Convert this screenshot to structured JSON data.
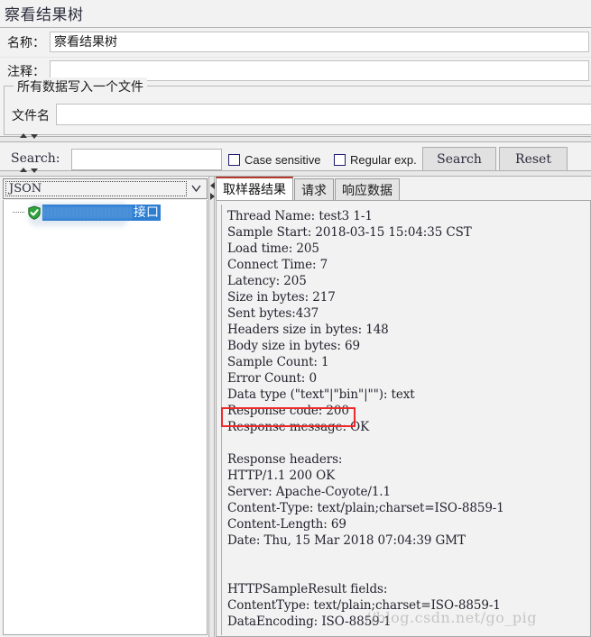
{
  "window": {
    "title": "察看结果树"
  },
  "form": {
    "name_label": "名称：",
    "name_value": "察看结果树",
    "comment_label": "注释：",
    "comment_value": "",
    "file_group_legend": "所有数据写入一个文件",
    "filename_label": "文件名",
    "filename_value": ""
  },
  "search": {
    "label": "Search:",
    "value": "",
    "case_sensitive_label": "Case sensitive",
    "case_sensitive_checked": false,
    "regular_exp_label": "Regular exp.",
    "regular_exp_checked": false,
    "search_button": "Search",
    "reset_button": "Reset"
  },
  "left_panel": {
    "renderer_selected": "JSON",
    "tree": {
      "node_label_visible": "接口",
      "node_status": "success"
    }
  },
  "right_panel": {
    "tabs": [
      {
        "label": "取样器结果",
        "active": true
      },
      {
        "label": "请求",
        "active": false
      },
      {
        "label": "响应数据",
        "active": false
      }
    ],
    "result_text": "Thread Name: test3 1-1\nSample Start: 2018-03-15 15:04:35 CST\nLoad time: 205\nConnect Time: 7\nLatency: 205\nSize in bytes: 217\nSent bytes:437\nHeaders size in bytes: 148\nBody size in bytes: 69\nSample Count: 1\nError Count: 0\nData type (\"text\"|\"bin\"|\"\"): text\nResponse code: 200\nResponse message: OK\n\nResponse headers:\nHTTP/1.1 200 OK\nServer: Apache-Coyote/1.1\nContent-Type: text/plain;charset=ISO-8859-1\nContent-Length: 69\nDate: Thu, 15 Mar 2018 07:04:39 GMT\n\n\nHTTPSampleResult fields:\nContentType: text/plain;charset=ISO-8859-1\nDataEncoding: ISO-8859-1"
  },
  "annotation": {
    "highlight_text": "Response code: 200",
    "color": "#ef2929"
  },
  "watermark": {
    "text": "//blog.csdn.net/go_pig"
  }
}
